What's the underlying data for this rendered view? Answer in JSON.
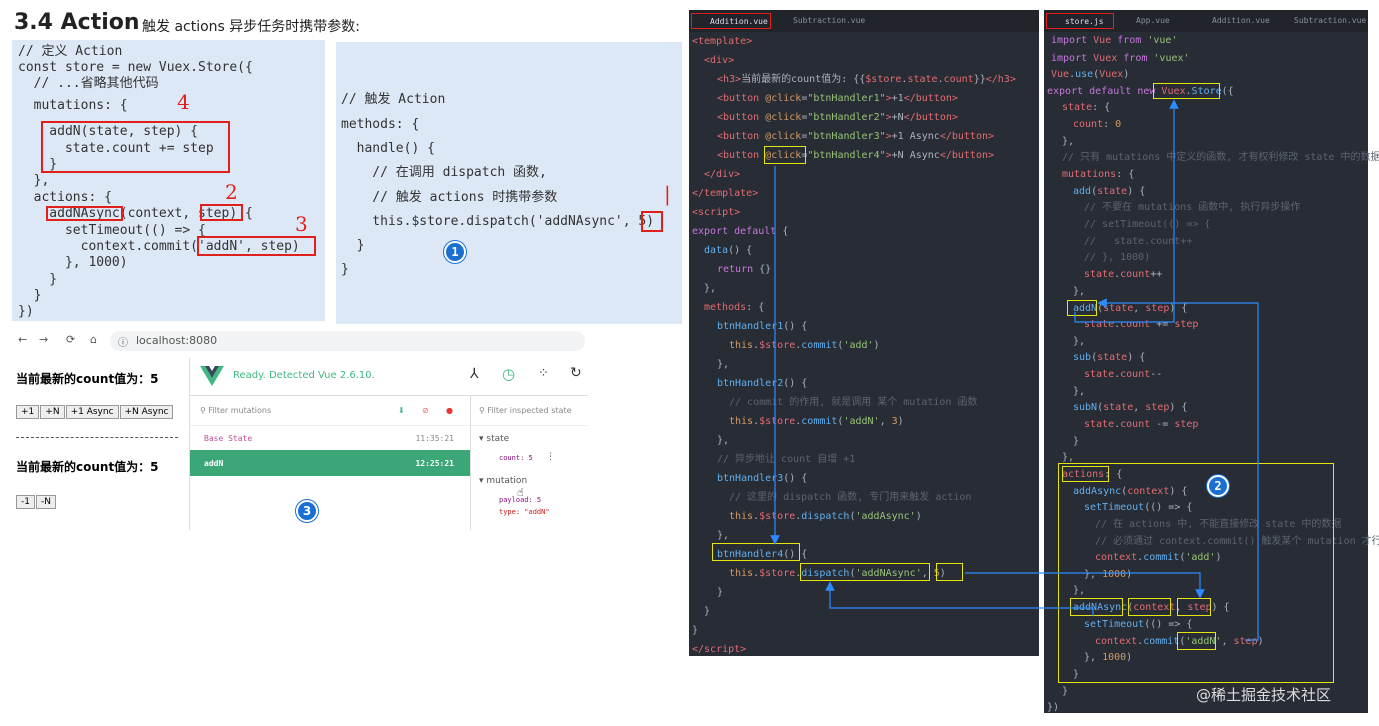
{
  "heading": {
    "title": "3.4 Action",
    "subtitle": "触发 actions 异步任务时携带参数:"
  },
  "code1": {
    "lines": [
      "// 定义 Action",
      "const store = new Vuex.Store({",
      "  // ...省略其他代码",
      "  mutations: {",
      "    addN(state, step) {",
      "      state.count += step",
      "    }",
      "  },",
      "  actions: {",
      "    addNAsync(context, step) {",
      "      setTimeout(() => {",
      "        context.commit('addN', step)",
      "      }, 1000)",
      "    }",
      "  }",
      "})"
    ]
  },
  "code2": {
    "lines": [
      "// 触发 Action",
      "methods: {",
      "  handle() {",
      "    // 在调用 dispatch 函数,",
      "    // 触发 actions 时携带参数",
      "    this.$store.dispatch('addNAsync', 5)",
      "  }",
      "}"
    ]
  },
  "badges": {
    "one": "1",
    "two": "2",
    "three": "3"
  },
  "browser": {
    "url": "localhost:8080",
    "count_label_1": "当前最新的count值为：5",
    "count_label_2": "当前最新的count值为：5",
    "buttons_1": [
      "+1",
      "+N",
      "+1 Async",
      "+N Async"
    ],
    "buttons_2": [
      "-1",
      "-N"
    ]
  },
  "devtools": {
    "status": "Ready. Detected Vue 2.6.10.",
    "filter_mutations": "Filter mutations",
    "filter_state": "Filter inspected state",
    "rows": [
      {
        "name": "Base State",
        "time": "11:35:21"
      },
      {
        "name": "addN",
        "time": "12:25:21"
      }
    ],
    "state_label": "state",
    "count_line": "count: 5",
    "mutation_label": "mutation",
    "payload_line": "payload: 5",
    "type_line": "type: \"addN\""
  },
  "editor1": {
    "tabs": [
      "Addition.vue",
      "Subtraction.vue"
    ]
  },
  "editor2": {
    "tabs": [
      "store.js",
      "App.vue",
      "Addition.vue",
      "Subtraction.vue"
    ]
  },
  "watermark": "@稀土掘金技术社区",
  "colors": {
    "panel": "#dde8f6",
    "editor_bg": "#282c34",
    "highlight": "#e5e510",
    "arrow": "#2b8cff",
    "annot": "#e0201a",
    "devtools_green": "#41b883"
  }
}
